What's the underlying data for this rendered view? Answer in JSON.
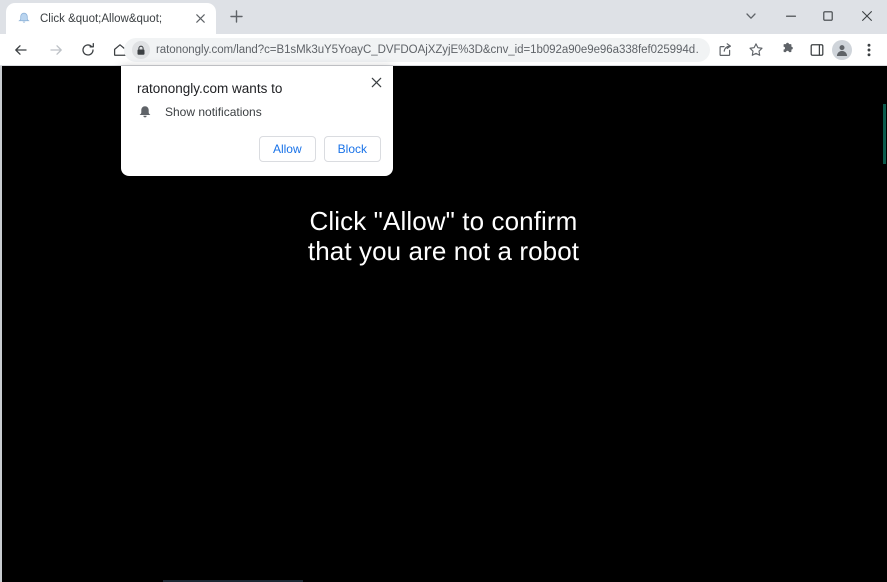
{
  "browser": {
    "tab": {
      "title": "Click &quot;Allow&quot;",
      "favicon_icon": "bell-favicon",
      "close_icon": "close-icon"
    },
    "new_tab_icon": "plus-icon",
    "window_controls": {
      "tab_search_icon": "chevron-down-icon",
      "minimize_icon": "minimize-icon",
      "maximize_icon": "maximize-icon",
      "close_icon": "close-icon"
    },
    "navigation": {
      "back_icon": "arrow-left-icon",
      "forward_icon": "arrow-right-icon",
      "reload_icon": "reload-icon",
      "home_icon": "home-icon"
    },
    "omnibox": {
      "lock_icon": "lock-icon",
      "url": "ratonongly.com/land?c=B1sMk3uY5YoayC_DVFDOAjXZyjE%3D&cnv_id=1b092a90e9e96a338fef025994d…"
    },
    "toolbar_icons": {
      "share_icon": "share-icon",
      "bookmark_icon": "star-icon",
      "extensions_icon": "puzzle-icon",
      "side_panel_icon": "side-panel-icon",
      "profile_icon": "avatar-icon",
      "menu_icon": "kebab-menu-icon"
    }
  },
  "permission_bubble": {
    "title": "ratonongly.com wants to",
    "permission_icon": "bell-icon",
    "permission_label": "Show notifications",
    "allow_label": "Allow",
    "block_label": "Block",
    "close_icon": "close-icon",
    "accent_color": "#1a73e8"
  },
  "page": {
    "background_color": "#000000",
    "text_color": "#ffffff",
    "headline_line_1": "Click \"Allow\" to confirm",
    "headline_line_2": "that you are not a robot"
  }
}
